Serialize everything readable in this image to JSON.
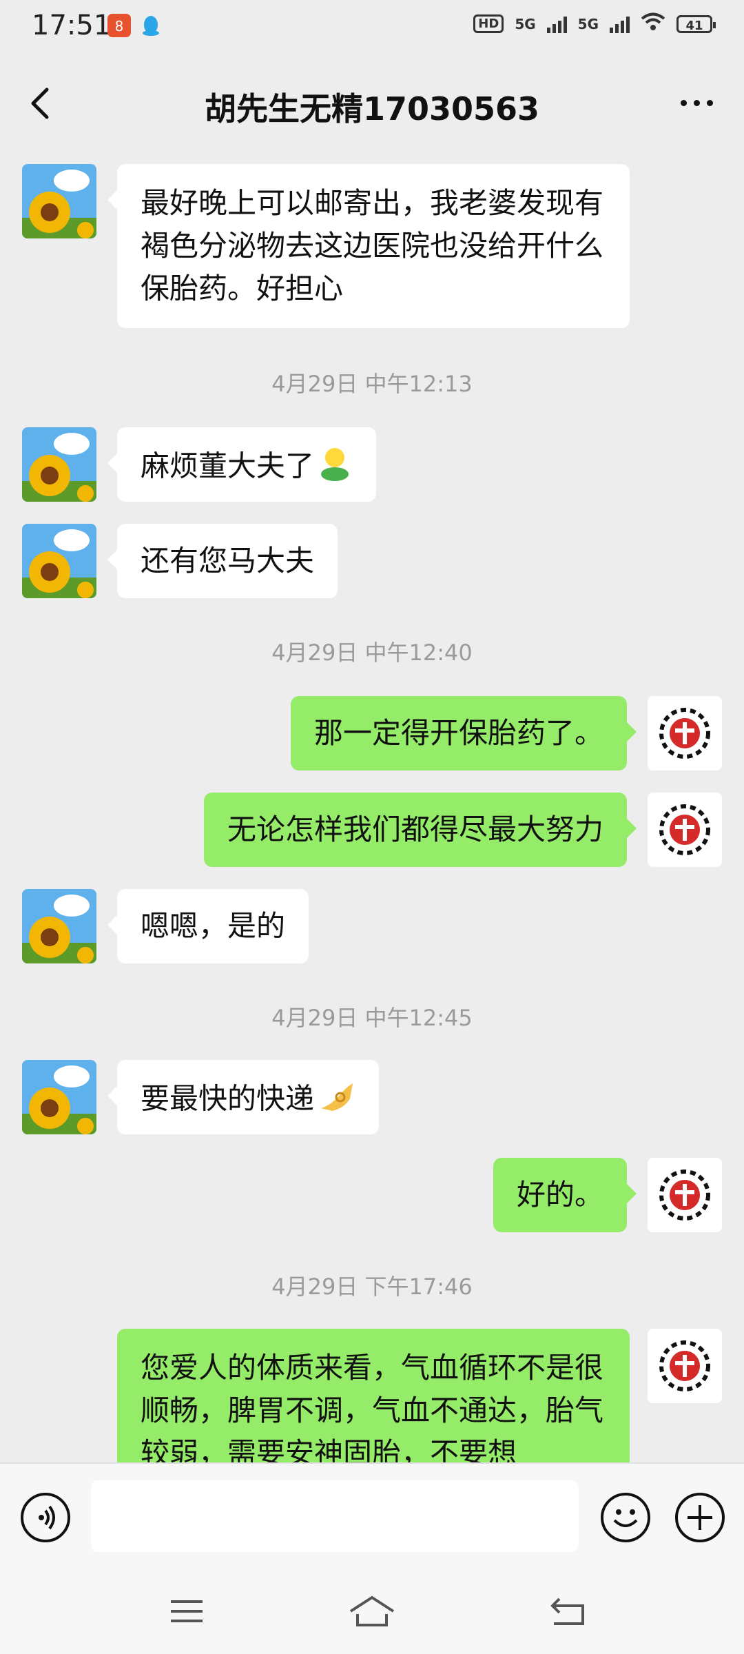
{
  "status_bar": {
    "time": "17:51",
    "network_left": "5G",
    "network_right": "5G",
    "hd": "HD",
    "battery": "41",
    "icons": [
      "app-icon-red",
      "qq-icon",
      "wifi-icon",
      "battery-icon"
    ]
  },
  "header": {
    "title": "胡先生无精17030563",
    "back_icon": "chevron-left-icon",
    "more_icon": "more-dots-icon"
  },
  "messages": [
    {
      "type": "text",
      "side": "left",
      "text": "最好晚上可以邮寄出，我老婆发现有褐色分泌物去这边医院也没给开什么保胎药。好担心"
    },
    {
      "type": "timestamp",
      "text": "4月29日 中午12:13"
    },
    {
      "type": "text",
      "side": "left",
      "text": "麻烦董大夫了",
      "emoji": "person-emoji"
    },
    {
      "type": "text",
      "side": "left",
      "text": "还有您马大夫"
    },
    {
      "type": "timestamp",
      "text": "4月29日 中午12:40"
    },
    {
      "type": "text",
      "side": "right",
      "text": "那一定得开保胎药了。"
    },
    {
      "type": "text",
      "side": "right",
      "text": "无论怎样我们都得尽最大努力"
    },
    {
      "type": "text",
      "side": "left",
      "text": "嗯嗯，是的"
    },
    {
      "type": "timestamp",
      "text": "4月29日 中午12:45"
    },
    {
      "type": "text",
      "side": "left",
      "text": "要最快的快递",
      "emoji": "ok-hand-emoji"
    },
    {
      "type": "text",
      "side": "right",
      "text": "好的。"
    },
    {
      "type": "timestamp",
      "text": "4月29日 下午17:46"
    },
    {
      "type": "text",
      "side": "right",
      "text": "您爱人的体质来看，气血循环不是很顺畅，脾胃不调，气血不通达，胎气较弱，需要安神固胎，不要想"
    }
  ],
  "input_bar": {
    "placeholder": "",
    "voice_icon": "voice-icon",
    "emoji_icon": "smiley-icon",
    "add_icon": "plus-icon"
  },
  "nav_bar": {
    "icons": [
      "menu-icon",
      "home-icon",
      "back-icon"
    ]
  },
  "colors": {
    "background": "#ededed",
    "bubble_self": "#95ec69",
    "bubble_other": "#ffffff",
    "timestamp": "#9a9a9a"
  }
}
